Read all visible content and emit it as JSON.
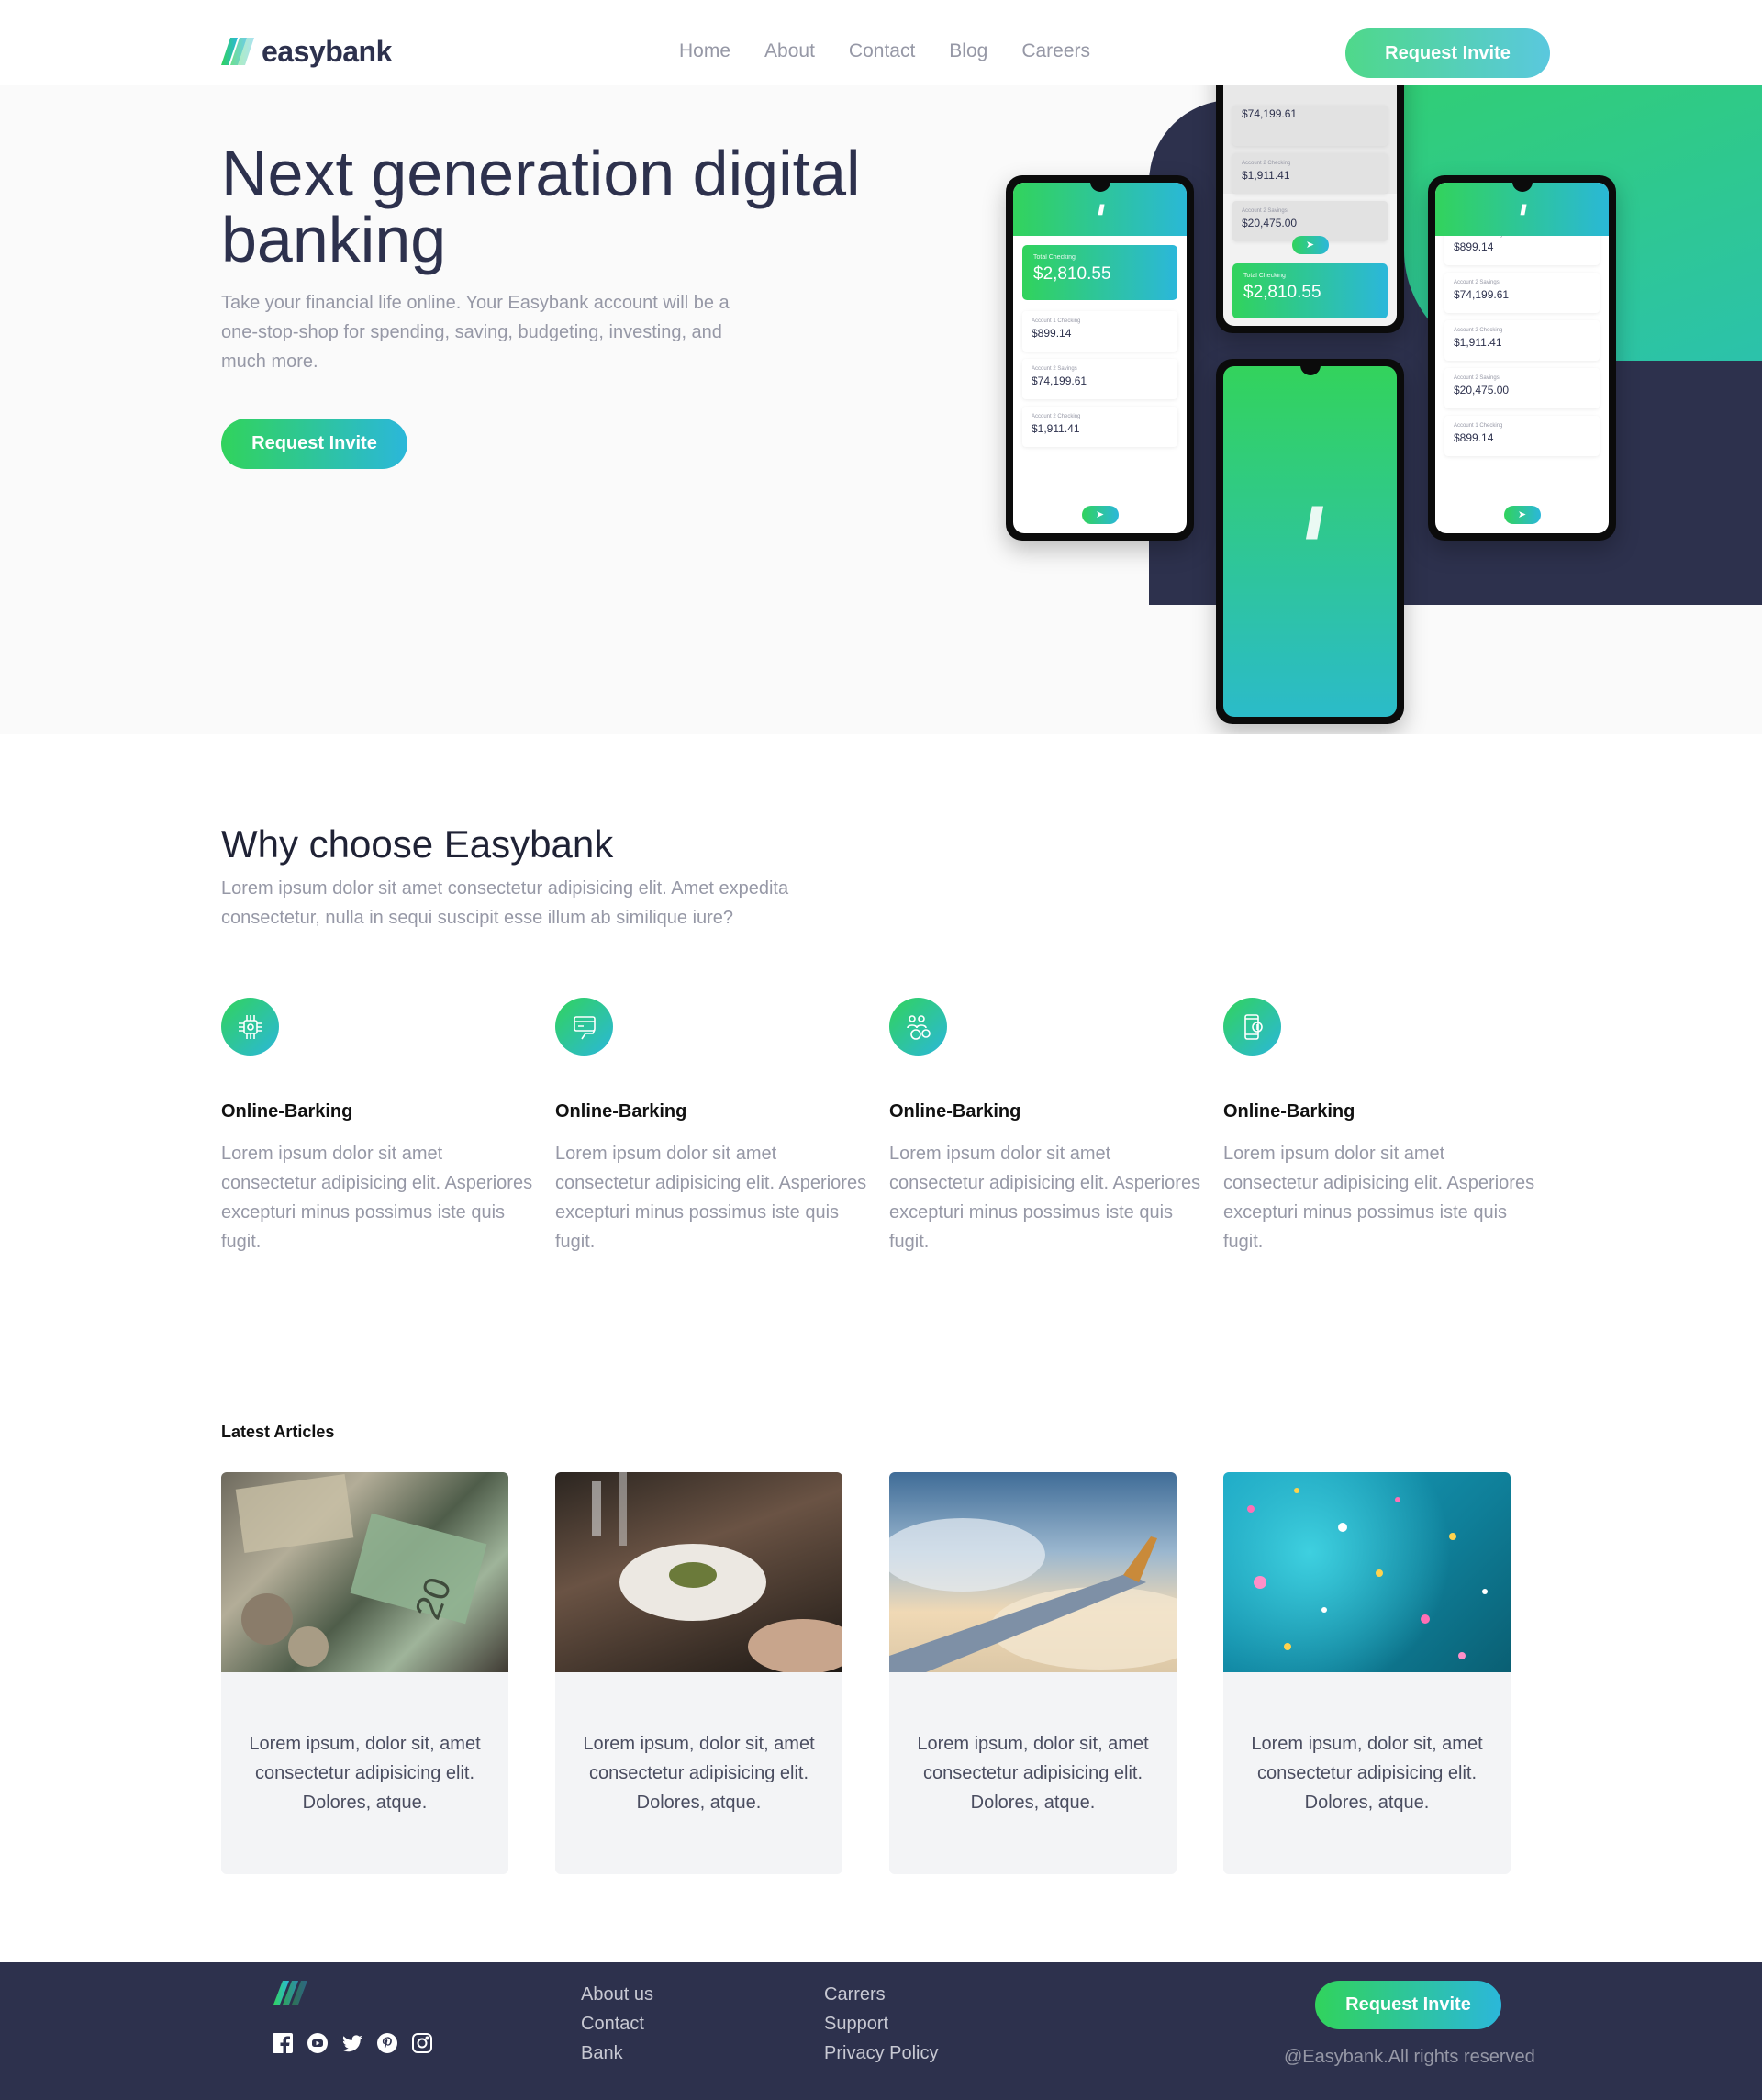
{
  "brand": {
    "name": "easybank",
    "gradient_start": "#31d35c",
    "gradient_end": "#2bb7da",
    "dark": "#2d314d"
  },
  "nav": {
    "links": [
      "Home",
      "About",
      "Contact",
      "Blog",
      "Careers"
    ],
    "cta": "Request Invite"
  },
  "hero": {
    "title": "Next generation digital banking",
    "text": "Take your financial life online. Your Easybank account will be a one-stop-shop for spending, saving, budgeting, investing, and much more.",
    "cta": "Request Invite",
    "phones": {
      "total_label": "Total Checking",
      "total": "$2,810.55",
      "accounts": [
        {
          "label": "Account 1 Checking",
          "amount": "$899.14"
        },
        {
          "label": "Account 2 Savings",
          "amount": "$74,199.61"
        },
        {
          "label": "Account 2 Checking",
          "amount": "$1,911.41"
        },
        {
          "label": "Account 2 Savings",
          "amount": "$20,475.00"
        },
        {
          "label": "Account 1 Checking",
          "amount": "$899.14"
        }
      ]
    }
  },
  "why": {
    "title": "Why choose Easybank",
    "subtitle": "Lorem ipsum dolor sit amet consectetur adipisicing elit. Amet expedita consectetur, nulla in sequi suscipit esse illum ab similique iure?",
    "features": [
      {
        "icon": "chip-icon",
        "title": "Online-Barking",
        "text": "Lorem ipsum dolor sit amet consectetur adipisicing elit. Asperiores excepturi minus possimus iste quis fugit."
      },
      {
        "icon": "card-hand-icon",
        "title": "Online-Barking",
        "text": "Lorem ipsum dolor sit amet consectetur adipisicing elit. Asperiores excepturi minus possimus iste quis fugit."
      },
      {
        "icon": "people-money-icon",
        "title": "Online-Barking",
        "text": "Lorem ipsum dolor sit amet consectetur adipisicing elit. Asperiores excepturi minus possimus iste quis fugit."
      },
      {
        "icon": "mobile-dollar-icon",
        "title": "Online-Barking",
        "text": "Lorem ipsum dolor sit amet consectetur adipisicing elit. Asperiores excepturi minus possimus iste quis fugit."
      }
    ]
  },
  "articles": {
    "heading": "Latest Articles",
    "items": [
      {
        "image": "money-photo",
        "text": "Lorem ipsum, dolor sit, amet consectetur adipisicing elit. Dolores, atque."
      },
      {
        "image": "dinner-photo",
        "text": "Lorem ipsum, dolor sit, amet consectetur adipisicing elit. Dolores, atque."
      },
      {
        "image": "plane-wing-photo",
        "text": "Lorem ipsum, dolor sit, amet consectetur adipisicing elit. Dolores, atque."
      },
      {
        "image": "confetti-photo",
        "text": "Lorem ipsum, dolor sit, amet consectetur adipisicing elit. Dolores, atque."
      }
    ]
  },
  "footer": {
    "socials": [
      "facebook-icon",
      "youtube-icon",
      "twitter-icon",
      "pinterest-icon",
      "instagram-icon"
    ],
    "col1": [
      "About us",
      "Contact",
      "Bank"
    ],
    "col2": [
      "Carrers",
      "Support",
      "Privacy Policy"
    ],
    "cta": "Request Invite",
    "copyright": "@Easybank.All rights reserved"
  }
}
